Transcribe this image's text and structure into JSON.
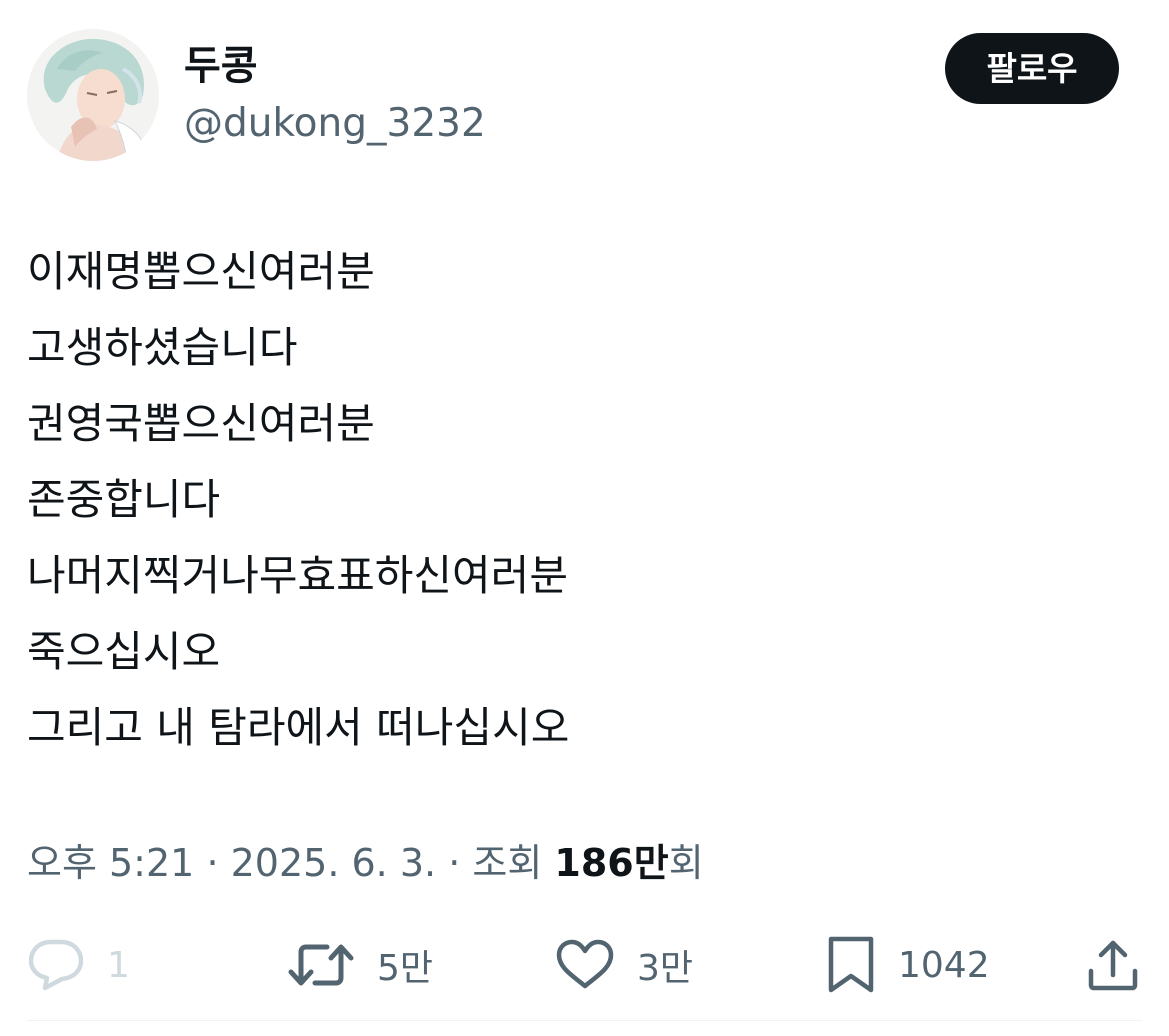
{
  "author": {
    "display_name": "두콩",
    "handle": "@dukong_3232",
    "follow_label": "팔로우"
  },
  "tweet": {
    "lines": [
      "이재명뽑으신여러분",
      "고생하셨습니다",
      "권영국뽑으신여러분",
      "존중합니다",
      "나머지찍거나무효표하신여러분",
      "죽으십시오",
      "그리고 내 탐라에서 떠나십시오"
    ]
  },
  "meta": {
    "time": "오후 5:21",
    "separator": "·",
    "date": "2025. 6. 3.",
    "views_label": "조회",
    "views_count": "186만",
    "views_suffix": "회"
  },
  "actions": {
    "reply": {
      "icon": "reply-icon",
      "count": "1"
    },
    "retweet": {
      "icon": "retweet-icon",
      "count": "5만"
    },
    "like": {
      "icon": "heart-icon",
      "count": "3만"
    },
    "bookmark": {
      "icon": "bookmark-icon",
      "count": "1042"
    },
    "share": {
      "icon": "share-icon"
    }
  },
  "colors": {
    "text_primary": "#0f1419",
    "text_secondary": "#536471",
    "reply_disabled": "#cfd9de",
    "follow_button_bg": "#0f1419",
    "follow_button_text": "#ffffff"
  }
}
